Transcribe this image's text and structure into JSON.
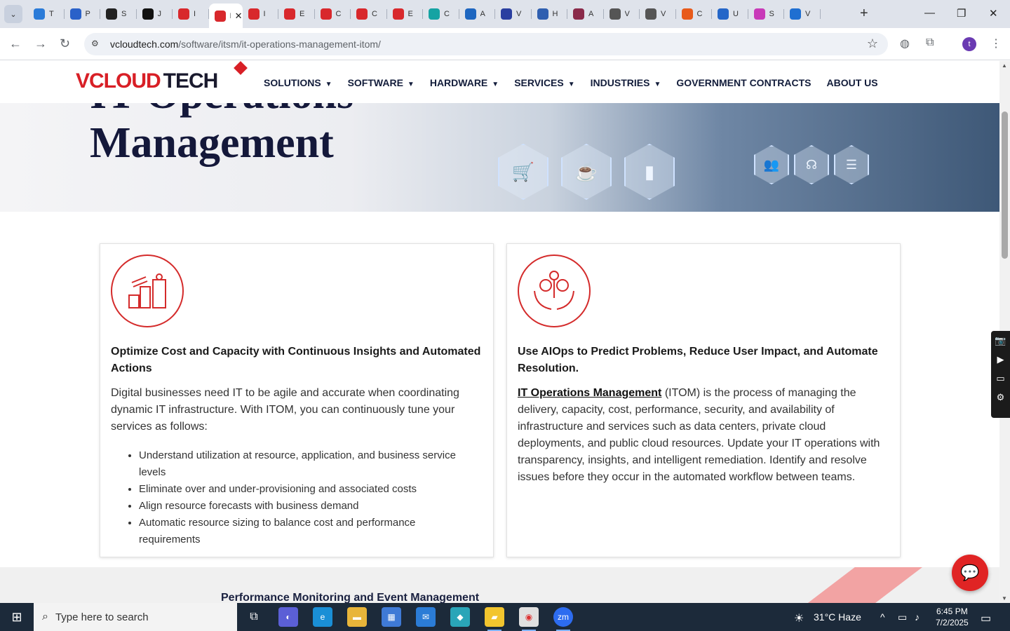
{
  "browser": {
    "tabs": [
      {
        "label": "T",
        "color": "#2b7bd8"
      },
      {
        "label": "P",
        "color": "#2a61c9"
      },
      {
        "label": "S",
        "color": "#222222"
      },
      {
        "label": "J",
        "color": "#111111"
      },
      {
        "label": "I",
        "color": "#d8282c"
      },
      {
        "label": "I",
        "color": "#d8282c"
      },
      {
        "label": "I",
        "color": "#d8282c"
      },
      {
        "label": "E",
        "color": "#d8282c"
      },
      {
        "label": "C",
        "color": "#d8282c"
      },
      {
        "label": "C",
        "color": "#d8282c"
      },
      {
        "label": "E",
        "color": "#d8282c"
      },
      {
        "label": "C",
        "color": "#15a3a3"
      },
      {
        "label": "A",
        "color": "#1e66c0"
      },
      {
        "label": "V",
        "color": "#2a3fa0"
      },
      {
        "label": "H",
        "color": "#2f5fb0"
      },
      {
        "label": "A",
        "color": "#8a2a4a"
      },
      {
        "label": "V",
        "color": "#555555"
      },
      {
        "label": "V",
        "color": "#555555"
      },
      {
        "label": "C",
        "color": "#e85a1a"
      },
      {
        "label": "U",
        "color": "#2566c8"
      },
      {
        "label": "S",
        "color": "#c83ab8"
      },
      {
        "label": "V",
        "color": "#1f6fd1"
      }
    ],
    "active_tab_label": "I",
    "url_domain": "vcloudtech.com",
    "url_path": "/software/itsm/it-operations-management-itom/",
    "avatar_letter": "t"
  },
  "site": {
    "logo_part1": "VCLOUD",
    "logo_part2": "TECH",
    "menu": [
      {
        "label": "SOLUTIONS",
        "dropdown": true
      },
      {
        "label": "SOFTWARE",
        "dropdown": true
      },
      {
        "label": "HARDWARE",
        "dropdown": true
      },
      {
        "label": "SERVICES",
        "dropdown": true
      },
      {
        "label": "INDUSTRIES",
        "dropdown": true
      },
      {
        "label": "GOVERNMENT CONTRACTS",
        "dropdown": false
      },
      {
        "label": "ABOUT US",
        "dropdown": false
      }
    ]
  },
  "hero": {
    "title_line1": "IT Operations",
    "title_line2": "Management"
  },
  "cards": [
    {
      "title": "Optimize Cost and Capacity with Continuous Insights and Automated Actions",
      "text": "Digital businesses need IT to be agile and accurate when coordinating dynamic IT infrastructure. With ITOM, you can continuously tune your services as follows:",
      "bullets": [
        "Understand utilization at resource, application, and business service levels",
        "Eliminate over and under-provisioning and associated costs",
        "Align resource forecasts with business demand",
        "Automatic resource sizing to balance cost and performance requirements"
      ]
    },
    {
      "title": "Use AIOps to Predict Problems, Reduce User Impact, and Automate Resolution.",
      "link_text": "IT Operations Management",
      "text": " (ITOM) is the process of managing the delivery, capacity, cost, performance, security, and availability of infrastructure and services such as data centers, private cloud deployments, and public cloud resources. Update your IT operations with transparency, insights, and intelligent remediation. Identify and resolve issues before they occur in the automated workflow between teams."
    }
  ],
  "lower_section": {
    "title": "Performance Monitoring and Event Management"
  },
  "taskbar": {
    "search_placeholder": "Type here to search",
    "weather": "31°C  Haze",
    "time": "6:45 PM",
    "date": "7/2/2025"
  },
  "colors": {
    "brand_red": "#d81f26",
    "nav_text": "#131d3b",
    "taskbar_bg": "#1c2a3a"
  }
}
